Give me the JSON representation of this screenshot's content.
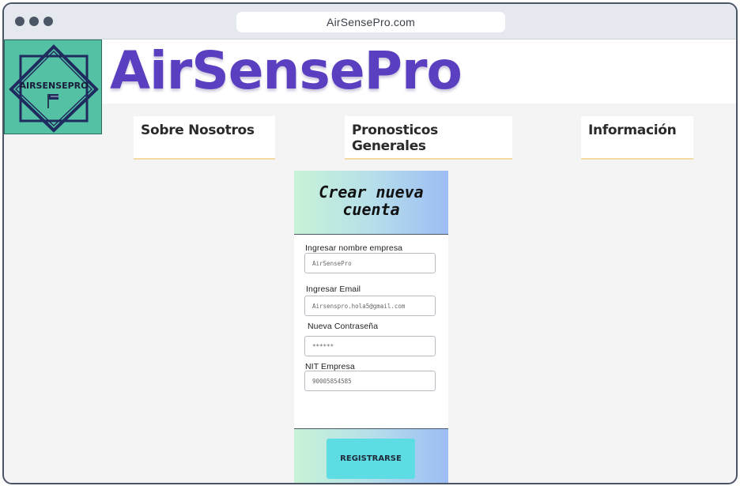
{
  "browser": {
    "url": "AirSensePro.com"
  },
  "brand": {
    "title": "AirSensePro",
    "logo_text": "AIRSENSEPRO",
    "logo_bg": "#55c1a4",
    "title_color": "#5a3fc0"
  },
  "nav": {
    "items": [
      {
        "label": "Sobre Nosotros"
      },
      {
        "label": "Pronosticos Generales"
      },
      {
        "label": "Información"
      }
    ]
  },
  "form": {
    "title_line1": "Crear nueva",
    "title_line2": "cuenta",
    "fields": [
      {
        "label": "Ingresar nombre empresa",
        "value": "AirSensePro"
      },
      {
        "label": "Ingresar Email",
        "value": "Airsenspro.hola5@gmail.com"
      },
      {
        "label": "Nueva Contraseña",
        "value": "******"
      },
      {
        "label": "NIT Empresa",
        "value": "90005854585"
      }
    ],
    "submit_label": "REGISTRARSE",
    "button_color": "#5ddce4"
  },
  "icons": {
    "window_controls": "three-dots-icon",
    "logo_emblem": "flag-icon"
  }
}
